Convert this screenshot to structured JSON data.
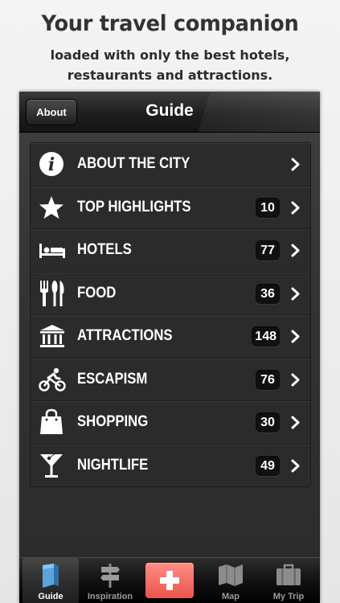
{
  "promo": {
    "title": "Your travel companion",
    "subtitle_line1": "loaded with only the best hotels,",
    "subtitle_line2": "restaurants and attractions."
  },
  "navbar": {
    "back_label": "About",
    "title": "Guide"
  },
  "menu": [
    {
      "label": "ABOUT THE CITY",
      "count": "",
      "icon": "info-icon"
    },
    {
      "label": "TOP HIGHLIGHTS",
      "count": "10",
      "icon": "star-icon"
    },
    {
      "label": "HOTELS",
      "count": "77",
      "icon": "bed-icon"
    },
    {
      "label": "FOOD",
      "count": "36",
      "icon": "cutlery-icon"
    },
    {
      "label": "ATTRACTIONS",
      "count": "148",
      "icon": "museum-icon"
    },
    {
      "label": "ESCAPISM",
      "count": "76",
      "icon": "cyclist-icon"
    },
    {
      "label": "SHOPPING",
      "count": "30",
      "icon": "shopping-bag-icon"
    },
    {
      "label": "NIGHTLIFE",
      "count": "49",
      "icon": "cocktail-icon"
    }
  ],
  "tabbar": {
    "guide": "Guide",
    "inspiration": "Inspiration",
    "add": "",
    "map": "Map",
    "my_trip": "My Trip"
  },
  "colors": {
    "accent": "#ef6a62",
    "background": "#333333"
  }
}
